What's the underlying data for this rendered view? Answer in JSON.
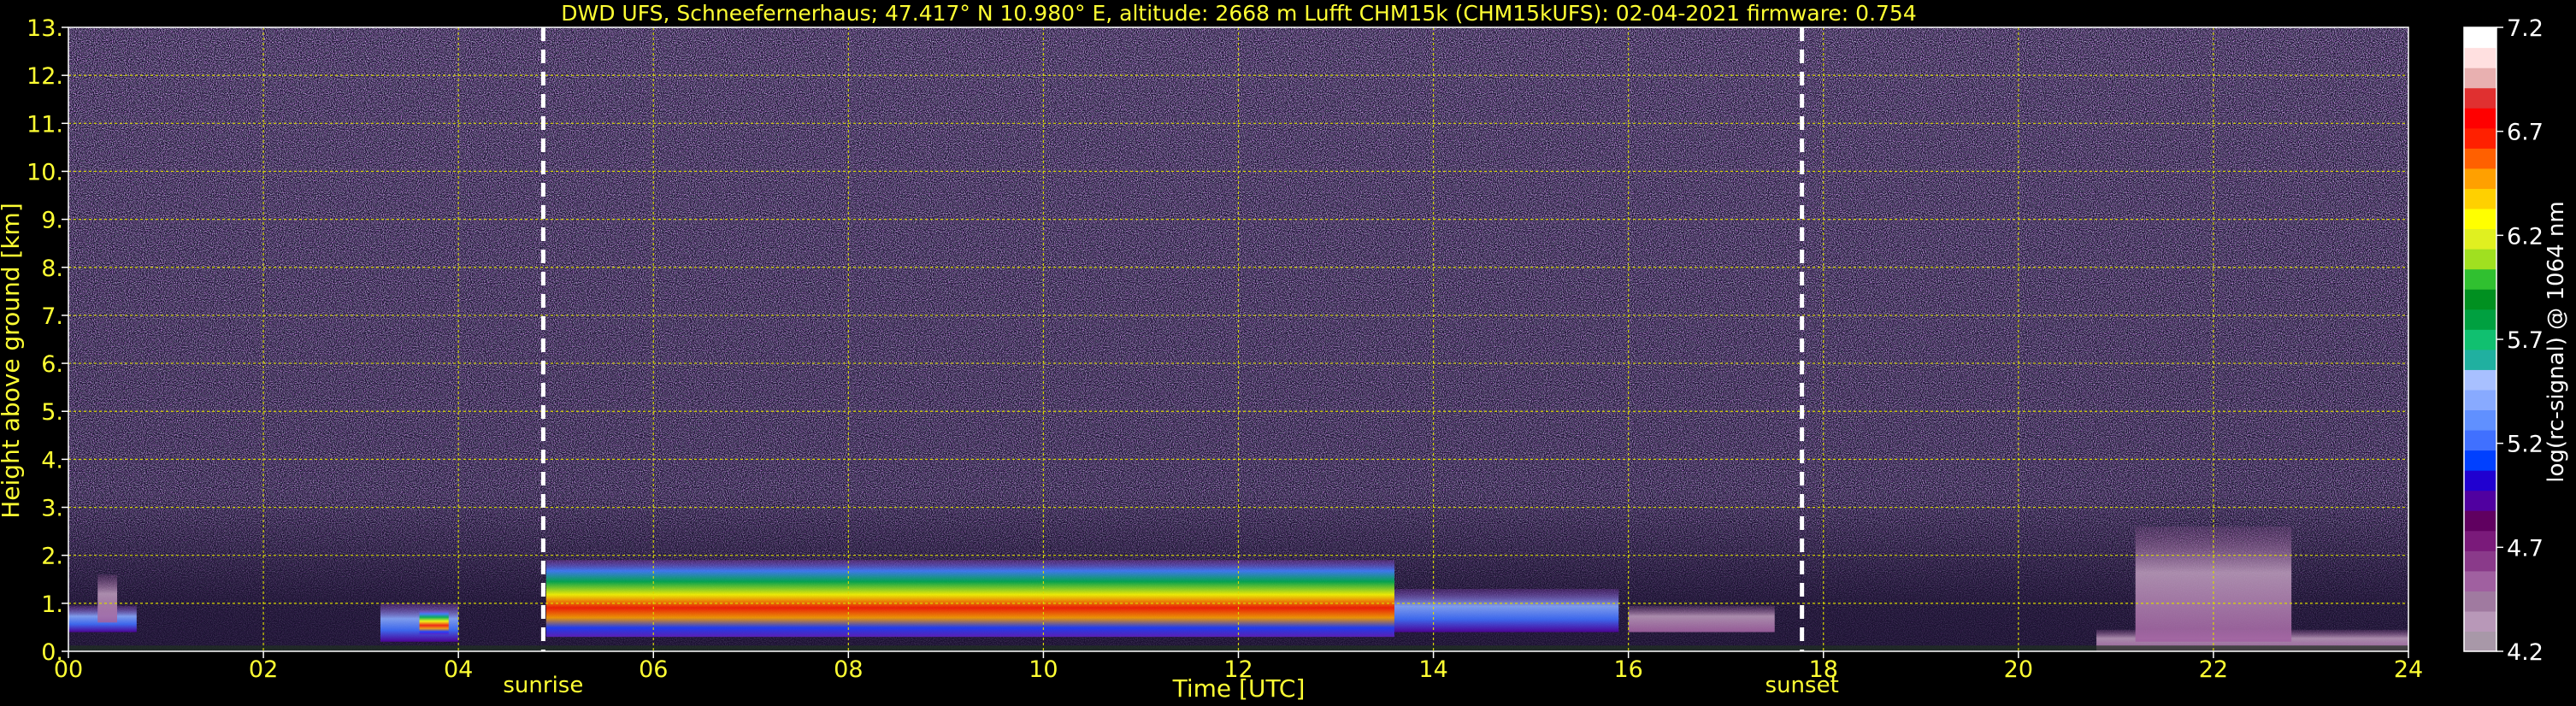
{
  "chart_data": {
    "type": "heatmap",
    "title": "DWD UFS, Schneefernerhaus; 47.417° N 10.980° E, altitude: 2668 m     Lufft CHM15k (CHM15kUFS): 02-04-2021     firmware: 0.754",
    "xlabel": "Time [UTC]",
    "ylabel": "Height above ground [km]",
    "xlim": [
      0,
      24
    ],
    "ylim": [
      0,
      13
    ],
    "x_ticks": [
      "00",
      "02",
      "04",
      "06",
      "08",
      "10",
      "12",
      "14",
      "16",
      "18",
      "20",
      "22",
      "24"
    ],
    "y_ticks": [
      "0.",
      "1.",
      "2.",
      "3.",
      "4.",
      "5.",
      "6.",
      "7.",
      "8.",
      "9.",
      "10.",
      "11.",
      "12.",
      "13."
    ],
    "grid": true,
    "events": [
      {
        "label": "sunrise",
        "time": 4.87
      },
      {
        "label": "sunset",
        "time": 17.78
      }
    ],
    "colorbar": {
      "label": "log(rc-signal) @ 1064 nm",
      "range": [
        4.2,
        7.2
      ],
      "ticks": [
        "4.2",
        "4.7",
        "5.2",
        "5.7",
        "6.2",
        "6.7",
        "7.2"
      ],
      "colors": [
        "#a898a8",
        "#b898b8",
        "#a07aa0",
        "#a060a0",
        "#8a3a8a",
        "#7a1a7a",
        "#600060",
        "#5000a0",
        "#2000d0",
        "#0040ff",
        "#4070ff",
        "#6090ff",
        "#88aaff",
        "#a8c0ff",
        "#20b0a0",
        "#10c070",
        "#00a040",
        "#009020",
        "#30c030",
        "#a0e020",
        "#e0f020",
        "#ffff00",
        "#ffd000",
        "#ffa000",
        "#ff6000",
        "#ff2000",
        "#ff0000",
        "#e03030",
        "#e8b0b0",
        "#ffe0e0",
        "#ffffff"
      ]
    },
    "cloud_layers": [
      {
        "x": [
          0.0,
          0.7
        ],
        "base_km": 0.4,
        "top_km": 0.95,
        "intensity": "medium"
      },
      {
        "x": [
          0.3,
          0.5
        ],
        "base_km": 0.6,
        "top_km": 1.6,
        "intensity": "weak"
      },
      {
        "x": [
          3.2,
          4.0
        ],
        "base_km": 0.2,
        "top_km": 1.0,
        "intensity": "medium"
      },
      {
        "x": [
          3.6,
          3.9
        ],
        "base_km": 0.35,
        "top_km": 0.85,
        "intensity": "strong"
      },
      {
        "x": [
          4.9,
          13.6
        ],
        "base_km": 0.3,
        "top_km": 1.9,
        "intensity": "strong"
      },
      {
        "x": [
          13.6,
          15.9
        ],
        "base_km": 0.4,
        "top_km": 1.3,
        "intensity": "medium"
      },
      {
        "x": [
          16.0,
          17.5
        ],
        "base_km": 0.4,
        "top_km": 0.95,
        "intensity": "weak"
      },
      {
        "x": [
          20.8,
          24.0
        ],
        "base_km": 0.0,
        "top_km": 0.45,
        "intensity": "weak"
      },
      {
        "x": [
          21.2,
          22.8
        ],
        "base_km": 0.2,
        "top_km": 2.6,
        "intensity": "weak"
      }
    ]
  }
}
